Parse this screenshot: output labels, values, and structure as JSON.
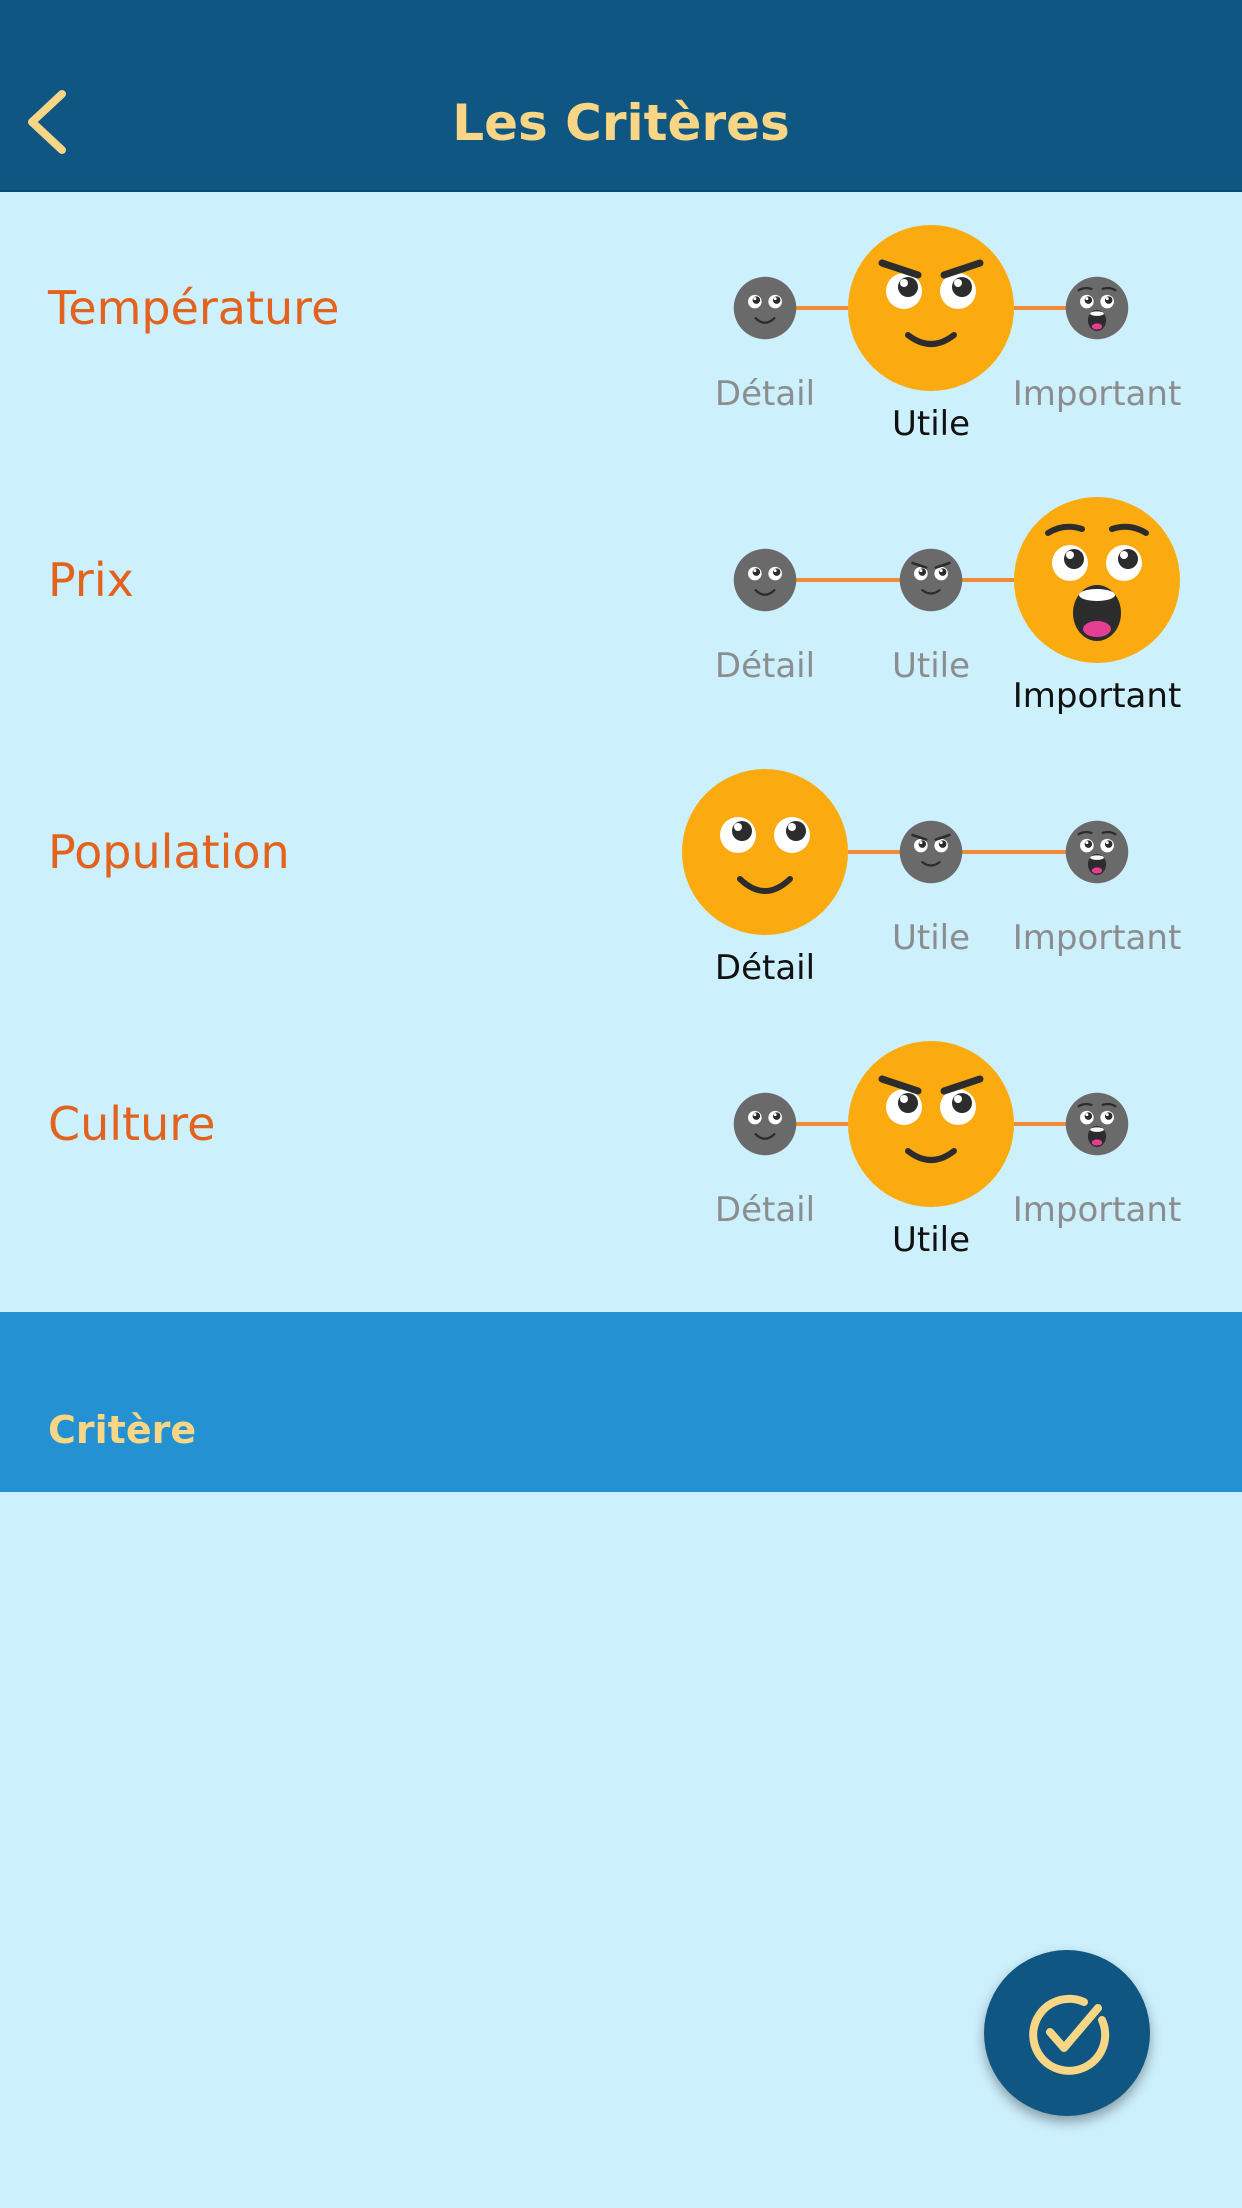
{
  "app_bar": {
    "title": "Les Critères",
    "back_icon": "chevron-left-icon"
  },
  "levels": [
    "Détail",
    "Utile",
    "Important"
  ],
  "criteria": [
    {
      "name": "Température",
      "selected": "Utile"
    },
    {
      "name": "Prix",
      "selected": "Important"
    },
    {
      "name": "Population",
      "selected": "Détail"
    },
    {
      "name": "Culture",
      "selected": "Utile"
    }
  ],
  "section": {
    "title": "Critère"
  },
  "fab": {
    "icon": "check-circle-icon"
  },
  "colors": {
    "app_bar": "#0f5683",
    "title": "#f8d685",
    "background": "#cdf0fd",
    "criterion_text": "#e2621e",
    "scale_line": "#f08a35",
    "emoji_active": "#fbab0f",
    "emoji_inactive": "#6a6a6a",
    "section_bar": "#2491d2"
  }
}
